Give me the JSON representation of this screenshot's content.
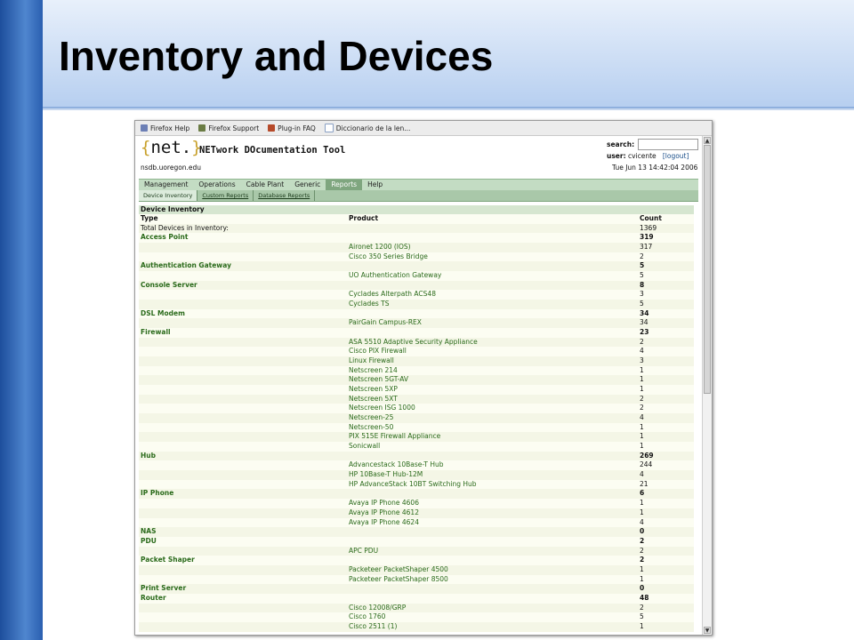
{
  "slide": {
    "title": "Inventory and Devices"
  },
  "browser": {
    "bookmarks": [
      {
        "label": "Firefox Help",
        "icon": "firefox-help-icon",
        "color": "#6c7fb5"
      },
      {
        "label": "Firefox Support",
        "icon": "firefox-support-icon",
        "color": "#6a7c44"
      },
      {
        "label": "Plug-in FAQ",
        "icon": "plugin-faq-icon",
        "color": "#b64a2a"
      },
      {
        "label": "Diccionario de la len...",
        "icon": "page-icon",
        "color": "#8aa0c4"
      }
    ]
  },
  "app": {
    "logo_open": "{",
    "logo_text": "net.",
    "logo_close": "}",
    "tool_title": "NETwork DOcumentation Tool",
    "host": "nsdb.uoregon.edu",
    "search_label": "search:",
    "search_value": "",
    "user_label": "user:",
    "user_name": "cvicente",
    "logout": "[logout]",
    "datetime": "Tue Jun 13 14:42:04 2006",
    "menu": [
      "Management",
      "Operations",
      "Cable Plant",
      "Generic",
      "Reports",
      "Help"
    ],
    "menu_active": "Reports",
    "submenu": [
      "Device Inventory",
      "Custom Reports",
      "Database Reports"
    ]
  },
  "inventory": {
    "title": "Device Inventory",
    "columns": [
      "Type",
      "Product",
      "Count"
    ],
    "rows": [
      {
        "kind": "total",
        "type": "Total Devices in Inventory:",
        "product": "",
        "count": "1369"
      },
      {
        "kind": "type",
        "type": "Access Point",
        "product": "",
        "count": "319"
      },
      {
        "kind": "prod",
        "type": "",
        "product": "Aironet 1200 (IOS)",
        "count": "317"
      },
      {
        "kind": "prod",
        "type": "",
        "product": "Cisco 350 Series Bridge",
        "count": "2"
      },
      {
        "kind": "type",
        "type": "Authentication Gateway",
        "product": "",
        "count": "5"
      },
      {
        "kind": "prod",
        "type": "",
        "product": "UO Authentication Gateway",
        "count": "5"
      },
      {
        "kind": "type",
        "type": "Console Server",
        "product": "",
        "count": "8"
      },
      {
        "kind": "prod",
        "type": "",
        "product": "Cyclades Alterpath ACS48",
        "count": "3"
      },
      {
        "kind": "prod",
        "type": "",
        "product": "Cyclades TS",
        "count": "5"
      },
      {
        "kind": "type",
        "type": "DSL Modem",
        "product": "",
        "count": "34"
      },
      {
        "kind": "prod",
        "type": "",
        "product": "PairGain Campus-REX",
        "count": "34"
      },
      {
        "kind": "type",
        "type": "Firewall",
        "product": "",
        "count": "23"
      },
      {
        "kind": "prod",
        "type": "",
        "product": "ASA 5510 Adaptive Security Appliance",
        "count": "2"
      },
      {
        "kind": "prod",
        "type": "",
        "product": "Cisco PIX Firewall",
        "count": "4"
      },
      {
        "kind": "prod",
        "type": "",
        "product": "Linux Firewall",
        "count": "3"
      },
      {
        "kind": "prod",
        "type": "",
        "product": "Netscreen 214",
        "count": "1"
      },
      {
        "kind": "prod",
        "type": "",
        "product": "Netscreen 5GT-AV",
        "count": "1"
      },
      {
        "kind": "prod",
        "type": "",
        "product": "Netscreen 5XP",
        "count": "1"
      },
      {
        "kind": "prod",
        "type": "",
        "product": "Netscreen 5XT",
        "count": "2"
      },
      {
        "kind": "prod",
        "type": "",
        "product": "Netscreen ISG 1000",
        "count": "2"
      },
      {
        "kind": "prod",
        "type": "",
        "product": "Netscreen-25",
        "count": "4"
      },
      {
        "kind": "prod",
        "type": "",
        "product": "Netscreen-50",
        "count": "1"
      },
      {
        "kind": "prod",
        "type": "",
        "product": "PIX 515E Firewall Appliance",
        "count": "1"
      },
      {
        "kind": "prod",
        "type": "",
        "product": "Sonicwall",
        "count": "1"
      },
      {
        "kind": "type",
        "type": "Hub",
        "product": "",
        "count": "269"
      },
      {
        "kind": "prod",
        "type": "",
        "product": "Advancestack 10Base-T Hub",
        "count": "244"
      },
      {
        "kind": "prod",
        "type": "",
        "product": "HP 10Base-T Hub-12M",
        "count": "4"
      },
      {
        "kind": "prod",
        "type": "",
        "product": "HP AdvanceStack 10BT Switching Hub",
        "count": "21"
      },
      {
        "kind": "type",
        "type": "IP Phone",
        "product": "",
        "count": "6"
      },
      {
        "kind": "prod",
        "type": "",
        "product": "Avaya IP Phone 4606",
        "count": "1"
      },
      {
        "kind": "prod",
        "type": "",
        "product": "Avaya IP Phone 4612",
        "count": "1"
      },
      {
        "kind": "prod",
        "type": "",
        "product": "Avaya IP Phone 4624",
        "count": "4"
      },
      {
        "kind": "type",
        "type": "NAS",
        "product": "",
        "count": "0"
      },
      {
        "kind": "type",
        "type": "PDU",
        "product": "",
        "count": "2"
      },
      {
        "kind": "prod",
        "type": "",
        "product": "APC PDU",
        "count": "2"
      },
      {
        "kind": "type",
        "type": "Packet Shaper",
        "product": "",
        "count": "2"
      },
      {
        "kind": "prod",
        "type": "",
        "product": "Packeteer PacketShaper 4500",
        "count": "1"
      },
      {
        "kind": "prod",
        "type": "",
        "product": "Packeteer PacketShaper 8500",
        "count": "1"
      },
      {
        "kind": "type",
        "type": "Print Server",
        "product": "",
        "count": "0"
      },
      {
        "kind": "type",
        "type": "Router",
        "product": "",
        "count": "48"
      },
      {
        "kind": "prod",
        "type": "",
        "product": "Cisco 12008/GRP",
        "count": "2"
      },
      {
        "kind": "prod",
        "type": "",
        "product": "Cisco 1760",
        "count": "5"
      },
      {
        "kind": "prod",
        "type": "",
        "product": "Cisco 2511 (1)",
        "count": "1"
      }
    ]
  }
}
